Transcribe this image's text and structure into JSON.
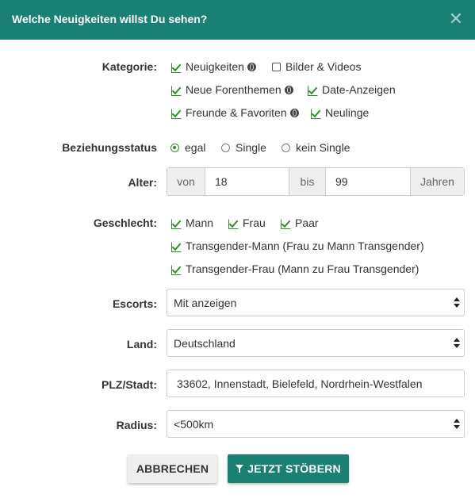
{
  "dialog": {
    "title": "Welche Neuigkeiten willst Du sehen?",
    "close_glyph": "✕"
  },
  "kategorie": {
    "label": "Kategorie:",
    "options": [
      {
        "label": "Neuigkeiten",
        "checked": true,
        "globe": true
      },
      {
        "label": "Bilder & Videos",
        "checked": false,
        "globe": false
      },
      {
        "label": "Neue Forenthemen",
        "checked": true,
        "globe": true
      },
      {
        "label": "Date-Anzeigen",
        "checked": true,
        "globe": false
      },
      {
        "label": "Freunde & Favoriten",
        "checked": true,
        "globe": true
      },
      {
        "label": "Neulinge",
        "checked": true,
        "globe": false
      }
    ]
  },
  "beziehungsstatus": {
    "label": "Beziehungsstatus",
    "options": [
      {
        "label": "egal",
        "selected": true
      },
      {
        "label": "Single",
        "selected": false
      },
      {
        "label": "kein Single",
        "selected": false
      }
    ]
  },
  "alter": {
    "label": "Alter:",
    "from_addon": "von",
    "from_value": "18",
    "to_addon": "bis",
    "to_value": "99",
    "unit": "Jahren"
  },
  "geschlecht": {
    "label": "Geschlecht:",
    "options": [
      {
        "label": "Mann",
        "checked": true
      },
      {
        "label": "Frau",
        "checked": true
      },
      {
        "label": "Paar",
        "checked": true
      },
      {
        "label": "Transgender-Mann (Frau zu Mann Transgender)",
        "checked": true
      },
      {
        "label": "Transgender-Frau (Mann zu Frau Transgender)",
        "checked": true
      }
    ]
  },
  "escorts": {
    "label": "Escorts:",
    "value": "Mit anzeigen"
  },
  "land": {
    "label": "Land:",
    "value": "Deutschland"
  },
  "plz": {
    "label": "PLZ/Stadt:",
    "value": "33602, Innenstadt, Bielefeld, Nordrhein-Westfalen"
  },
  "radius": {
    "label": "Radius:",
    "value": "<500km"
  },
  "buttons": {
    "cancel": "ABBRECHEN",
    "submit": "JETZT STÖBERN"
  },
  "colors": {
    "accent": "#1a8074",
    "check": "#2e8f2a"
  }
}
